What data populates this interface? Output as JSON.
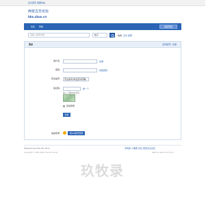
{
  "topbar": {
    "links": [
      "设为首页",
      "收藏本站"
    ]
  },
  "site": {
    "name": "西安古交论坛",
    "domain": "bbs.xbus.cn"
  },
  "nav": {
    "items": [
      "论坛",
      "导航"
    ],
    "quick_nav": "快捷导航"
  },
  "search": {
    "placeholder": "请输入搜索内容",
    "type": "帖子",
    "links": [
      "热搜:",
      "正式",
      "招聘"
    ]
  },
  "login": {
    "title": "登录",
    "register_link": "没有帐号？注册",
    "username_label": "用户名:",
    "username_side": "注册",
    "password_label": "密码:",
    "password_side": "找回密码",
    "question_label": "安全提问:",
    "question_value": "安全提问(未设置请忽略)",
    "captcha_label": "验证码:",
    "captcha_refresh": "换一个",
    "captcha_hint": "输入下图中的字符",
    "remember_label": "自动登录",
    "submit_label": "登录",
    "quick_login_label": "快捷登录:",
    "qq_label": "用QQ帐号登录"
  },
  "footer": {
    "powered": "Powered by Discuz! X3.4",
    "copyright": "Copyright © 2001-2020, Tencent Cloud.",
    "links": [
      "手机版",
      "小黑屋",
      "论坛",
      "西安古交论坛"
    ],
    "gmt": "GMT+8, 2025-3-21 03:11"
  },
  "watermark": {
    "text": "玖牧录"
  }
}
